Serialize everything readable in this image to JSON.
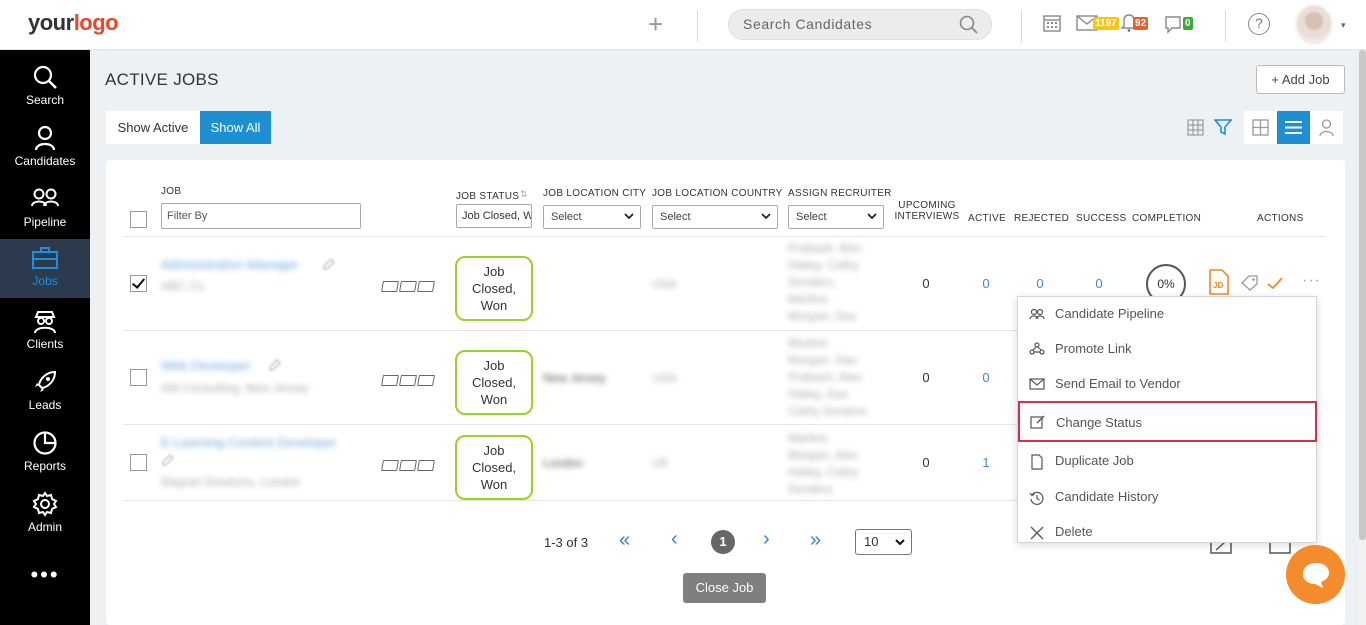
{
  "topbar": {
    "logo_part1": "your",
    "logo_part2": "logo",
    "search_placeholder": "Search Candidates",
    "mail_count": "1197",
    "notif_count": "92",
    "chat_count": "0",
    "help_label": "?"
  },
  "sidebar": {
    "items": [
      {
        "label": "Search",
        "icon": "search-icon"
      },
      {
        "label": "Candidates",
        "icon": "user-icon"
      },
      {
        "label": "Pipeline",
        "icon": "pipeline-icon"
      },
      {
        "label": "Jobs",
        "icon": "briefcase-icon",
        "active": true
      },
      {
        "label": "Clients",
        "icon": "clients-icon"
      },
      {
        "label": "Leads",
        "icon": "rocket-icon"
      },
      {
        "label": "Reports",
        "icon": "pie-chart-icon"
      },
      {
        "label": "Admin",
        "icon": "gear-icon"
      }
    ],
    "more": "•••"
  },
  "page": {
    "title": "ACTIVE JOBS",
    "add_job": "+ Add Job",
    "show_active": "Show Active",
    "show_all": "Show All"
  },
  "table": {
    "headers": {
      "job": "JOB",
      "job_status": "JOB STATUS",
      "city": "JOB LOCATION CITY",
      "country": "JOB LOCATION COUNTRY",
      "recruiter": "ASSIGN RECRUITER",
      "upcoming_1": "UPCOMING",
      "upcoming_2": "INTERVIEWS",
      "active": "ACTIVE",
      "rejected": "REJECTED",
      "success": "SUCCESS",
      "completion": "COMPLETION",
      "actions": "ACTIONS"
    },
    "filters": {
      "job_placeholder": "Filter By",
      "status_value": "Job Closed, W",
      "city_select": "Select",
      "country_select": "Select",
      "recruiter_select": "Select"
    },
    "rows": [
      {
        "title": "Administration Manager",
        "company": "ABC Co",
        "status_1": "Job",
        "status_2": "Closed,",
        "status_3": "Won",
        "city": "",
        "country": "USA",
        "recruiters": [
          "Prabash, Alex",
          "Hailey, Cathy",
          "Senders,",
          "Marlton",
          "Morgan, Dav"
        ],
        "upcoming": "0",
        "active": "0",
        "rejected": "0",
        "success": "0",
        "completion": "0%",
        "checked": true
      },
      {
        "title": "Web Developer",
        "company": "AM Consulting, New Jersey",
        "status_1": "Job",
        "status_2": "Closed,",
        "status_3": "Won",
        "city": "New Jersey",
        "country": "USA",
        "recruiters": [
          "Marlton",
          "Morgan, Dav",
          "Prabash, Alex",
          "Hailey, Dav",
          "Cathy Senders"
        ],
        "upcoming": "0",
        "active": "0",
        "checked": false
      },
      {
        "title": "E-Learning Content Developer",
        "company": "Magnet Solutions, London",
        "status_1": "Job",
        "status_2": "Closed,",
        "status_3": "Won",
        "city": "London",
        "country": "UK",
        "recruiters": [
          "Marlton",
          "Morgan, Alex",
          "Hailey, Cathy",
          "Senders"
        ],
        "upcoming": "0",
        "active": "1",
        "checked": false
      }
    ]
  },
  "pagination": {
    "range": "1-3 of 3",
    "current": "1",
    "page_size": "10",
    "close_job": "Close Job"
  },
  "menu": {
    "items": [
      {
        "label": "Candidate Pipeline",
        "icon": "pipeline-icon"
      },
      {
        "label": "Promote Link",
        "icon": "promote-icon"
      },
      {
        "label": "Send Email to Vendor",
        "icon": "mail-icon"
      },
      {
        "label": "Change Status",
        "icon": "edit-icon",
        "highlighted": true
      },
      {
        "label": "Duplicate Job",
        "icon": "document-icon"
      },
      {
        "label": "Candidate History",
        "icon": "history-icon"
      },
      {
        "label": "Delete",
        "icon": "close-icon"
      }
    ]
  },
  "colors": {
    "accent": "#1e8fd0",
    "status_border": "#9ad324",
    "highlight": "#d3304a",
    "chat_button": "#f58c2b"
  }
}
